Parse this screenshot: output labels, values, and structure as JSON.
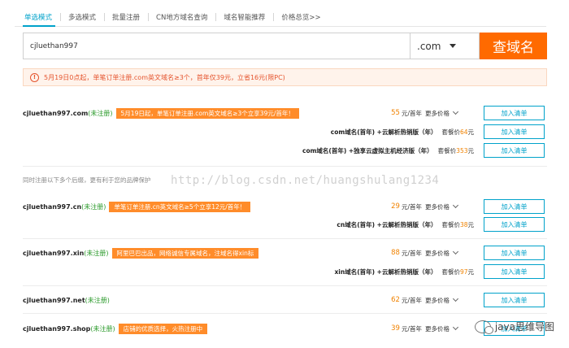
{
  "tabs": [
    {
      "label": "单选模式",
      "active": true
    },
    {
      "label": "多选模式",
      "active": false
    },
    {
      "label": "批量注册",
      "active": false
    },
    {
      "label": "CN地方域名查询",
      "active": false
    },
    {
      "label": "域名智能推荐",
      "active": false
    },
    {
      "label": "价格总览>>",
      "active": false
    }
  ],
  "search": {
    "value": "cjluethan997",
    "suffix": ".com",
    "button": "查域名"
  },
  "notice": {
    "icon": "!",
    "text": "5月19日0点起，单笔订单注册.com英文域名≥3个，首年仅39元，立省16元(限PC)"
  },
  "results_top": [
    {
      "name": "cjluethan997.com",
      "status": "(未注册)",
      "promo": "5月19日起，单笔订单注册.com英文域名≥3个立享39元/首年！",
      "price": "55",
      "unit": "元/首年",
      "more": "更多价格",
      "cart": "加入清单"
    }
  ],
  "com_packages": [
    {
      "name": "com域名(首年) +云解析热销版（年）",
      "label": "套餐价",
      "price": "64",
      "unit": "元",
      "cart": "加入清单"
    },
    {
      "name": "com域名(首年) +独享云虚拟主机经济版（年）",
      "label": "套餐价",
      "price": "353",
      "unit": "元",
      "cart": "加入清单"
    }
  ],
  "hint": "同时注册以下多个后缀，更有利于您的品牌保护",
  "watermark": "http://blog.csdn.net/huangshulang1234",
  "results": [
    {
      "name": "cjluethan997.cn",
      "status": "(未注册)",
      "promo": "单笔订单注册.cn英文域名≥5个立享12元/首年！",
      "price": "29",
      "unit": "元/首年",
      "more": "更多价格",
      "cart": "加入清单",
      "package": {
        "name": "cn域名(首年) +云解析热销版（年）",
        "label": "套餐价",
        "price": "38",
        "unit": "元",
        "cart": "加入清单"
      }
    },
    {
      "name": "cjluethan997.xin",
      "status": "(未注册)",
      "promo": "阿里巴巴出品，网络诚信专属域名，注域名得xin标",
      "price": "88",
      "unit": "元/首年",
      "more": "更多价格",
      "cart": "加入清单",
      "package": {
        "name": "xin域名(首年) +云解析热销版（年）",
        "label": "套餐价",
        "price": "97",
        "unit": "元",
        "cart": "加入清单"
      }
    },
    {
      "name": "cjluethan997.net",
      "status": "(未注册)",
      "promo": "",
      "price": "62",
      "unit": "元/首年",
      "more": "更多价格",
      "cart": "加入清单"
    },
    {
      "name": "cjluethan997.shop",
      "status": "(未注册)",
      "promo": "店铺的优质选择，火热注册中",
      "price": "39",
      "unit": "元/首年",
      "more": "更多价格",
      "cart": "加入清单"
    }
  ],
  "brand": "java思维导图",
  "colors": {
    "accent": "#00a2ca",
    "orange": "#ff6a00",
    "price": "#f08200",
    "status": "#2a9a2a"
  }
}
